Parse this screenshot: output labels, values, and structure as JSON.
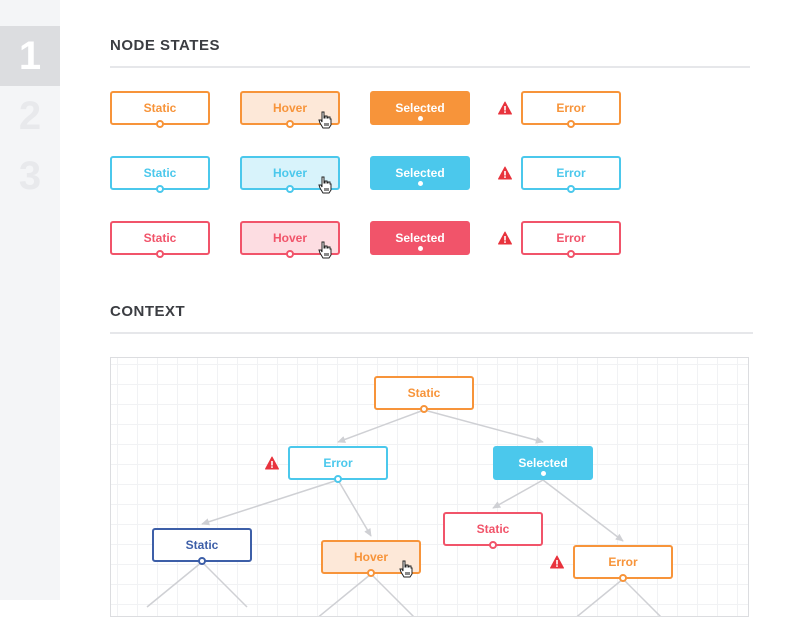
{
  "sidebar": {
    "steps": [
      {
        "label": "1",
        "active": true
      },
      {
        "label": "2",
        "active": false
      },
      {
        "label": "3",
        "active": false
      }
    ]
  },
  "sections": {
    "node_states": {
      "title": "NODE STATES"
    },
    "context": {
      "title": "CONTEXT"
    }
  },
  "colors": {
    "orange": "#f7943a",
    "orange_hover_bg": "#fde8d8",
    "blue": "#4bc8ec",
    "blue_hover_bg": "#d8f3fb",
    "red": "#f1546a",
    "red_hover_bg": "#fddde2",
    "navy": "#3d5fa8",
    "warning": "#e8333d",
    "edge": "#cfd0d4"
  },
  "node_states": {
    "rows": [
      {
        "theme": "orange",
        "nodes": [
          {
            "label": "Static",
            "state": "static"
          },
          {
            "label": "Hover",
            "state": "hover"
          },
          {
            "label": "Selected",
            "state": "selected"
          },
          {
            "label": "Error",
            "state": "error"
          }
        ]
      },
      {
        "theme": "blue",
        "nodes": [
          {
            "label": "Static",
            "state": "static"
          },
          {
            "label": "Hover",
            "state": "hover"
          },
          {
            "label": "Selected",
            "state": "selected"
          },
          {
            "label": "Error",
            "state": "error"
          }
        ]
      },
      {
        "theme": "red",
        "nodes": [
          {
            "label": "Static",
            "state": "static"
          },
          {
            "label": "Hover",
            "state": "hover"
          },
          {
            "label": "Selected",
            "state": "selected"
          },
          {
            "label": "Error",
            "state": "error"
          }
        ]
      }
    ]
  },
  "context": {
    "nodes": [
      {
        "id": "root",
        "label": "Static",
        "state": "static",
        "theme": "orange"
      },
      {
        "id": "a",
        "label": "Error",
        "state": "error",
        "theme": "blue"
      },
      {
        "id": "b",
        "label": "Selected",
        "state": "selected",
        "theme": "blue"
      },
      {
        "id": "a1",
        "label": "Static",
        "state": "static",
        "theme": "navy"
      },
      {
        "id": "a2",
        "label": "Hover",
        "state": "hover",
        "theme": "orange"
      },
      {
        "id": "b1",
        "label": "Static",
        "state": "static",
        "theme": "red"
      },
      {
        "id": "b2",
        "label": "Error",
        "state": "error",
        "theme": "orange"
      }
    ],
    "edges": [
      {
        "from": "root",
        "to": "a"
      },
      {
        "from": "root",
        "to": "b"
      },
      {
        "from": "a",
        "to": "a1"
      },
      {
        "from": "a",
        "to": "a2"
      },
      {
        "from": "b",
        "to": "b1"
      },
      {
        "from": "b",
        "to": "b2"
      }
    ]
  }
}
